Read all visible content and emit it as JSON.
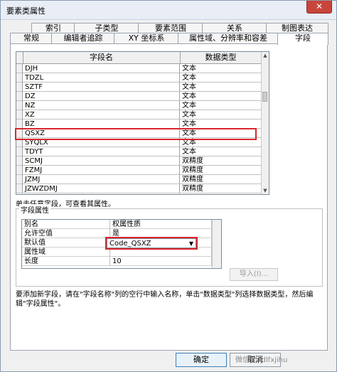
{
  "window": {
    "title": "要素类属性",
    "close_label": "✕"
  },
  "tabs_row1": [
    "索引",
    "子类型",
    "要素范围",
    "关系",
    "制图表达"
  ],
  "tabs_row2": [
    "常规",
    "编辑者追踪",
    "XY 坐标系",
    "属性域、分辨率和容差",
    "字段"
  ],
  "active_tab": "字段",
  "fields_grid": {
    "headers": [
      "字段名",
      "数据类型"
    ],
    "rows": [
      {
        "name": "DJH",
        "type": "文本"
      },
      {
        "name": "TDZL",
        "type": "文本"
      },
      {
        "name": "SZTF",
        "type": "文本"
      },
      {
        "name": "DZ",
        "type": "文本"
      },
      {
        "name": "NZ",
        "type": "文本"
      },
      {
        "name": "XZ",
        "type": "文本"
      },
      {
        "name": "BZ",
        "type": "文本"
      },
      {
        "name": "QSXZ",
        "type": "文本"
      },
      {
        "name": "SYQLX",
        "type": "文本"
      },
      {
        "name": "TDYT",
        "type": "文本"
      },
      {
        "name": "SCMJ",
        "type": "双精度"
      },
      {
        "name": "FZMJ",
        "type": "双精度"
      },
      {
        "name": "JZMJ",
        "type": "双精度"
      },
      {
        "name": "JZWZDMJ",
        "type": "双精度"
      }
    ],
    "highlighted_row": "QSXZ"
  },
  "hint": "单击任意字段，可查看其属性。",
  "field_props": {
    "legend": "字段属性",
    "rows": [
      {
        "key": "别名",
        "value": "权属性质"
      },
      {
        "key": "允许空值",
        "value": "是"
      },
      {
        "key": "默认值",
        "value": ""
      },
      {
        "key": "属性域",
        "value": ""
      },
      {
        "key": "长度",
        "value": "10"
      }
    ],
    "domain_dropdown": "Code_QSXZ",
    "import_label": "导入(I)..."
  },
  "description": "要添加新字段，请在\"字段名称\"列的空行中输入名称，单击\"数据类型\"列选择数据类型，然后编辑\"字段属性\"。",
  "buttons": {
    "ok": "确定",
    "cancel": "取消"
  },
  "watermark": "微信号: dlfxjihu",
  "colors": {
    "highlight": "#d9272e",
    "close": "#c9453b"
  }
}
